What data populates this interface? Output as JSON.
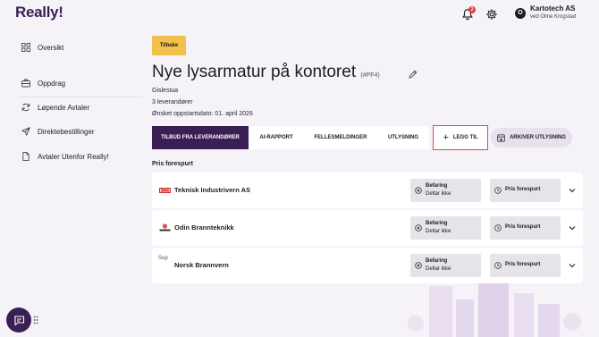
{
  "app": {
    "logo": "Really!"
  },
  "header": {
    "notification_count": "2",
    "company": "Kartotech AS",
    "user": "ved Oline Krogstad",
    "avatar_initial": "O"
  },
  "sidebar": {
    "items": [
      {
        "label": "Oversikt",
        "icon": "grid-icon"
      },
      {
        "label": "Oppdrag",
        "icon": "briefcase-icon"
      },
      {
        "label": "Løpende Avtaler",
        "icon": "refresh-icon"
      },
      {
        "label": "Direktebestillinger",
        "icon": "send-icon"
      },
      {
        "label": "Avtaler Utenfor Really!",
        "icon": "document-icon"
      }
    ]
  },
  "main": {
    "back_label": "Tilbake",
    "title": "Nye lysarmatur på kontoret",
    "code": "(#PF4)",
    "location": "Gislestua",
    "supplier_count": "3 leverandører",
    "start_date": "Ønsket oppstartsdato: 01. april 2026",
    "tabs": [
      {
        "label": "TILBUD FRA LEVERANDØRER",
        "active": true
      },
      {
        "label": "AI-RAPPORT",
        "active": false
      },
      {
        "label": "FELLESMELDINGER",
        "active": false
      },
      {
        "label": "UTLYSNING",
        "active": false
      }
    ],
    "add_label": "LEGG TIL",
    "archive_label": "ARKIVER UTLYSNING",
    "section_label": "Pris forespurt",
    "suppliers": [
      {
        "name": "Teknisk Industrivern AS",
        "logo_alt": "",
        "status_title": "Befaring",
        "status_sub": "Deltar ikke",
        "price_label": "Pris forespurt"
      },
      {
        "name": "Odin Brannteknikk",
        "logo_alt": "",
        "status_title": "Befaring",
        "status_sub": "Deltar ikke",
        "price_label": "Pris forespurt"
      },
      {
        "name": "Norsk Brannvern",
        "logo_alt": "Sup",
        "status_title": "Befaring",
        "status_sub": "Deltar ikke",
        "price_label": "Pris forespurt"
      }
    ]
  },
  "colors": {
    "brand": "#3a1f55",
    "accent_yellow": "#f0c14b",
    "highlight_red": "#e34848",
    "background": "#f5f3f8"
  }
}
